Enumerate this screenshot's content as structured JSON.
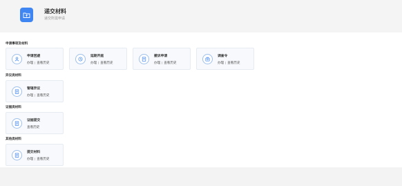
{
  "header": {
    "title": "递交材料",
    "subtitle": "递交所需申请",
    "icon": "folder-upload-icon",
    "accent": "#3f86f3"
  },
  "sections": [
    {
      "title": "申请事项及材料",
      "cards": [
        {
          "title": "申请回避",
          "icon": "person-icon",
          "actions": [
            "办理",
            "查看历史"
          ]
        },
        {
          "title": "延期开庭",
          "icon": "clock-icon",
          "actions": [
            "办理",
            "查看历史"
          ]
        },
        {
          "title": "撤诉申请",
          "icon": "document-icon",
          "actions": [
            "办理",
            "查看历史"
          ]
        },
        {
          "title": "调查令",
          "icon": "badge-icon",
          "actions": [
            "办理",
            "查看历史"
          ]
        }
      ]
    },
    {
      "title": "异议类材料",
      "cards": [
        {
          "title": "管辖异议",
          "icon": "document-icon",
          "actions": [
            "办理",
            "查看历史"
          ]
        }
      ]
    },
    {
      "title": "证据类材料",
      "cards": [
        {
          "title": "证据提交",
          "icon": "document-icon",
          "actions": [
            "查看历史"
          ]
        }
      ]
    },
    {
      "title": "其他类材料",
      "cards": [
        {
          "title": "提交材料",
          "icon": "document-icon",
          "actions": [
            "办理",
            "查看历史"
          ]
        }
      ]
    }
  ]
}
